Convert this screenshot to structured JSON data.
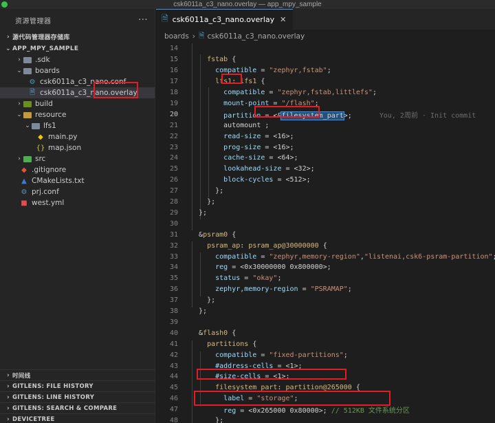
{
  "window": {
    "title": "csk6011a_c3_nano.overlay — app_mpy_sample"
  },
  "sidebar": {
    "header": "资源管理器",
    "more_icon": "ellipsis-icon",
    "scm_section": "源代码管理器存储库",
    "explorer_section": "APP_MPY_SAMPLE",
    "items": [
      {
        "label": ".sdk",
        "type": "folder",
        "depth": 1,
        "expanded": false
      },
      {
        "label": "boards",
        "type": "folder",
        "depth": 1,
        "expanded": true
      },
      {
        "label": "csk6011a_c3_nano.conf",
        "type": "gear",
        "depth": 2
      },
      {
        "label": "csk6011a_c3_nano.overlay",
        "type": "doc",
        "depth": 2,
        "selected": true
      },
      {
        "label": "build",
        "type": "folder",
        "depth": 1,
        "expanded": false
      },
      {
        "label": "resource",
        "type": "folder",
        "depth": 1,
        "expanded": true
      },
      {
        "label": "lfs1",
        "type": "folder",
        "depth": 2,
        "expanded": true
      },
      {
        "label": "main.py",
        "type": "python",
        "depth": 3
      },
      {
        "label": "map.json",
        "type": "json",
        "depth": 3
      },
      {
        "label": "src",
        "type": "folder",
        "depth": 1,
        "expanded": false
      },
      {
        "label": ".gitignore",
        "type": "git",
        "depth": 1
      },
      {
        "label": "CMakeLists.txt",
        "type": "cmake",
        "depth": 1
      },
      {
        "label": "prj.conf",
        "type": "gear",
        "depth": 1
      },
      {
        "label": "west.yml",
        "type": "yml",
        "depth": 1
      }
    ],
    "bottom_sections": [
      "时间线",
      "GITLENS: FILE HISTORY",
      "GITLENS: LINE HISTORY",
      "GITLENS: SEARCH & COMPARE",
      "DEVICETREE"
    ]
  },
  "editor": {
    "tab_label": "csk6011a_c3_nano.overlay",
    "close_icon": "close-icon",
    "breadcrumb": [
      "boards",
      "csk6011a_c3_nano.overlay"
    ],
    "blame": "You, 2周前 · Init commit",
    "lines": [
      {
        "n": "14",
        "t": ""
      },
      {
        "n": "15",
        "t": "    fstab {"
      },
      {
        "n": "16",
        "t": "      compatible = \"zephyr,fstab\";"
      },
      {
        "n": "17",
        "t": "      lfs1: lfs1 {"
      },
      {
        "n": "18",
        "t": "        compatible = \"zephyr,fstab,littlefs\";"
      },
      {
        "n": "19",
        "t": "        mount-point = \"/flash\";"
      },
      {
        "n": "20",
        "t": "        partition = <&filesystem_part>;"
      },
      {
        "n": "21",
        "t": "        automount ;"
      },
      {
        "n": "22",
        "t": "        read-size = <16>;"
      },
      {
        "n": "23",
        "t": "        prog-size = <16>;"
      },
      {
        "n": "24",
        "t": "        cache-size = <64>;"
      },
      {
        "n": "25",
        "t": "        lookahead-size = <32>;"
      },
      {
        "n": "26",
        "t": "        block-cycles = <512>;"
      },
      {
        "n": "27",
        "t": "      };"
      },
      {
        "n": "28",
        "t": "    };"
      },
      {
        "n": "29",
        "t": "  };"
      },
      {
        "n": "30",
        "t": ""
      },
      {
        "n": "31",
        "t": "  &psram0 {"
      },
      {
        "n": "32",
        "t": "    psram_ap: psram_ap@30000000 {"
      },
      {
        "n": "33",
        "t": "      compatible = \"zephyr,memory-region\",\"listenai,csk6-psram-partition\";"
      },
      {
        "n": "34",
        "t": "      reg = <0x30000000 0x800000>;"
      },
      {
        "n": "35",
        "t": "      status = \"okay\";"
      },
      {
        "n": "36",
        "t": "      zephyr,memory-region = \"PSRAMAP\";"
      },
      {
        "n": "37",
        "t": "    };"
      },
      {
        "n": "38",
        "t": "  };"
      },
      {
        "n": "39",
        "t": ""
      },
      {
        "n": "40",
        "t": "  &flash0 {"
      },
      {
        "n": "41",
        "t": "    partitions {"
      },
      {
        "n": "42",
        "t": "      compatible = \"fixed-partitions\";"
      },
      {
        "n": "43",
        "t": "      #address-cells = <1>;"
      },
      {
        "n": "44",
        "t": "      #size-cells = <1>;"
      },
      {
        "n": "45",
        "t": "      filesystem_part: partition@265000 {"
      },
      {
        "n": "46",
        "t": "        label = \"storage\";"
      },
      {
        "n": "47",
        "t": "        reg = <0x265000 0x80000>; // 512KB 文件系统分区"
      },
      {
        "n": "48",
        "t": "      };"
      },
      {
        "n": "49",
        "t": "    };"
      }
    ]
  }
}
